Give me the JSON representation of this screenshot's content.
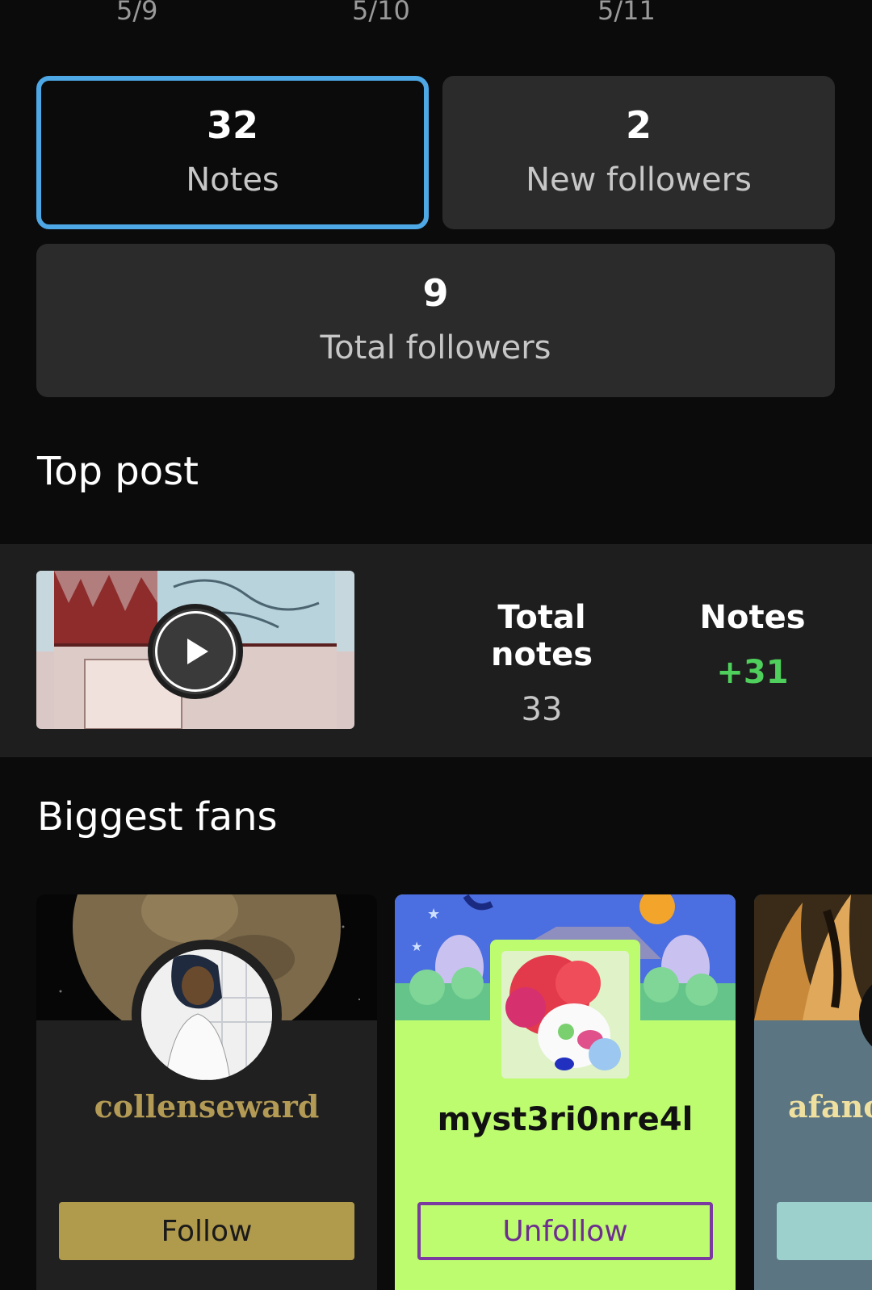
{
  "dates": [
    "5/9",
    "5/10",
    "5/11"
  ],
  "stats": {
    "notes": {
      "value": "32",
      "label": "Notes"
    },
    "new_followers": {
      "value": "2",
      "label": "New followers"
    },
    "total_followers": {
      "value": "9",
      "label": "Total followers"
    }
  },
  "top_post": {
    "title": "Top post",
    "total_notes_label": "Total notes",
    "total_notes_value": "33",
    "notes_label": "Notes",
    "notes_value": "+31"
  },
  "biggest_fans": {
    "title": "Biggest fans",
    "fans": [
      {
        "name": "collenseward",
        "button": "Follow"
      },
      {
        "name": "myst3ri0nre4l",
        "button": "Unfollow"
      },
      {
        "name": "afano"
      }
    ]
  },
  "colors": {
    "selected_border": "#4ea8e6",
    "positive": "#4fcf5b",
    "follow_button": "#b09a4c",
    "unfollow_card": "#bdfc6e",
    "unfollow_border": "#7a3aa0"
  }
}
